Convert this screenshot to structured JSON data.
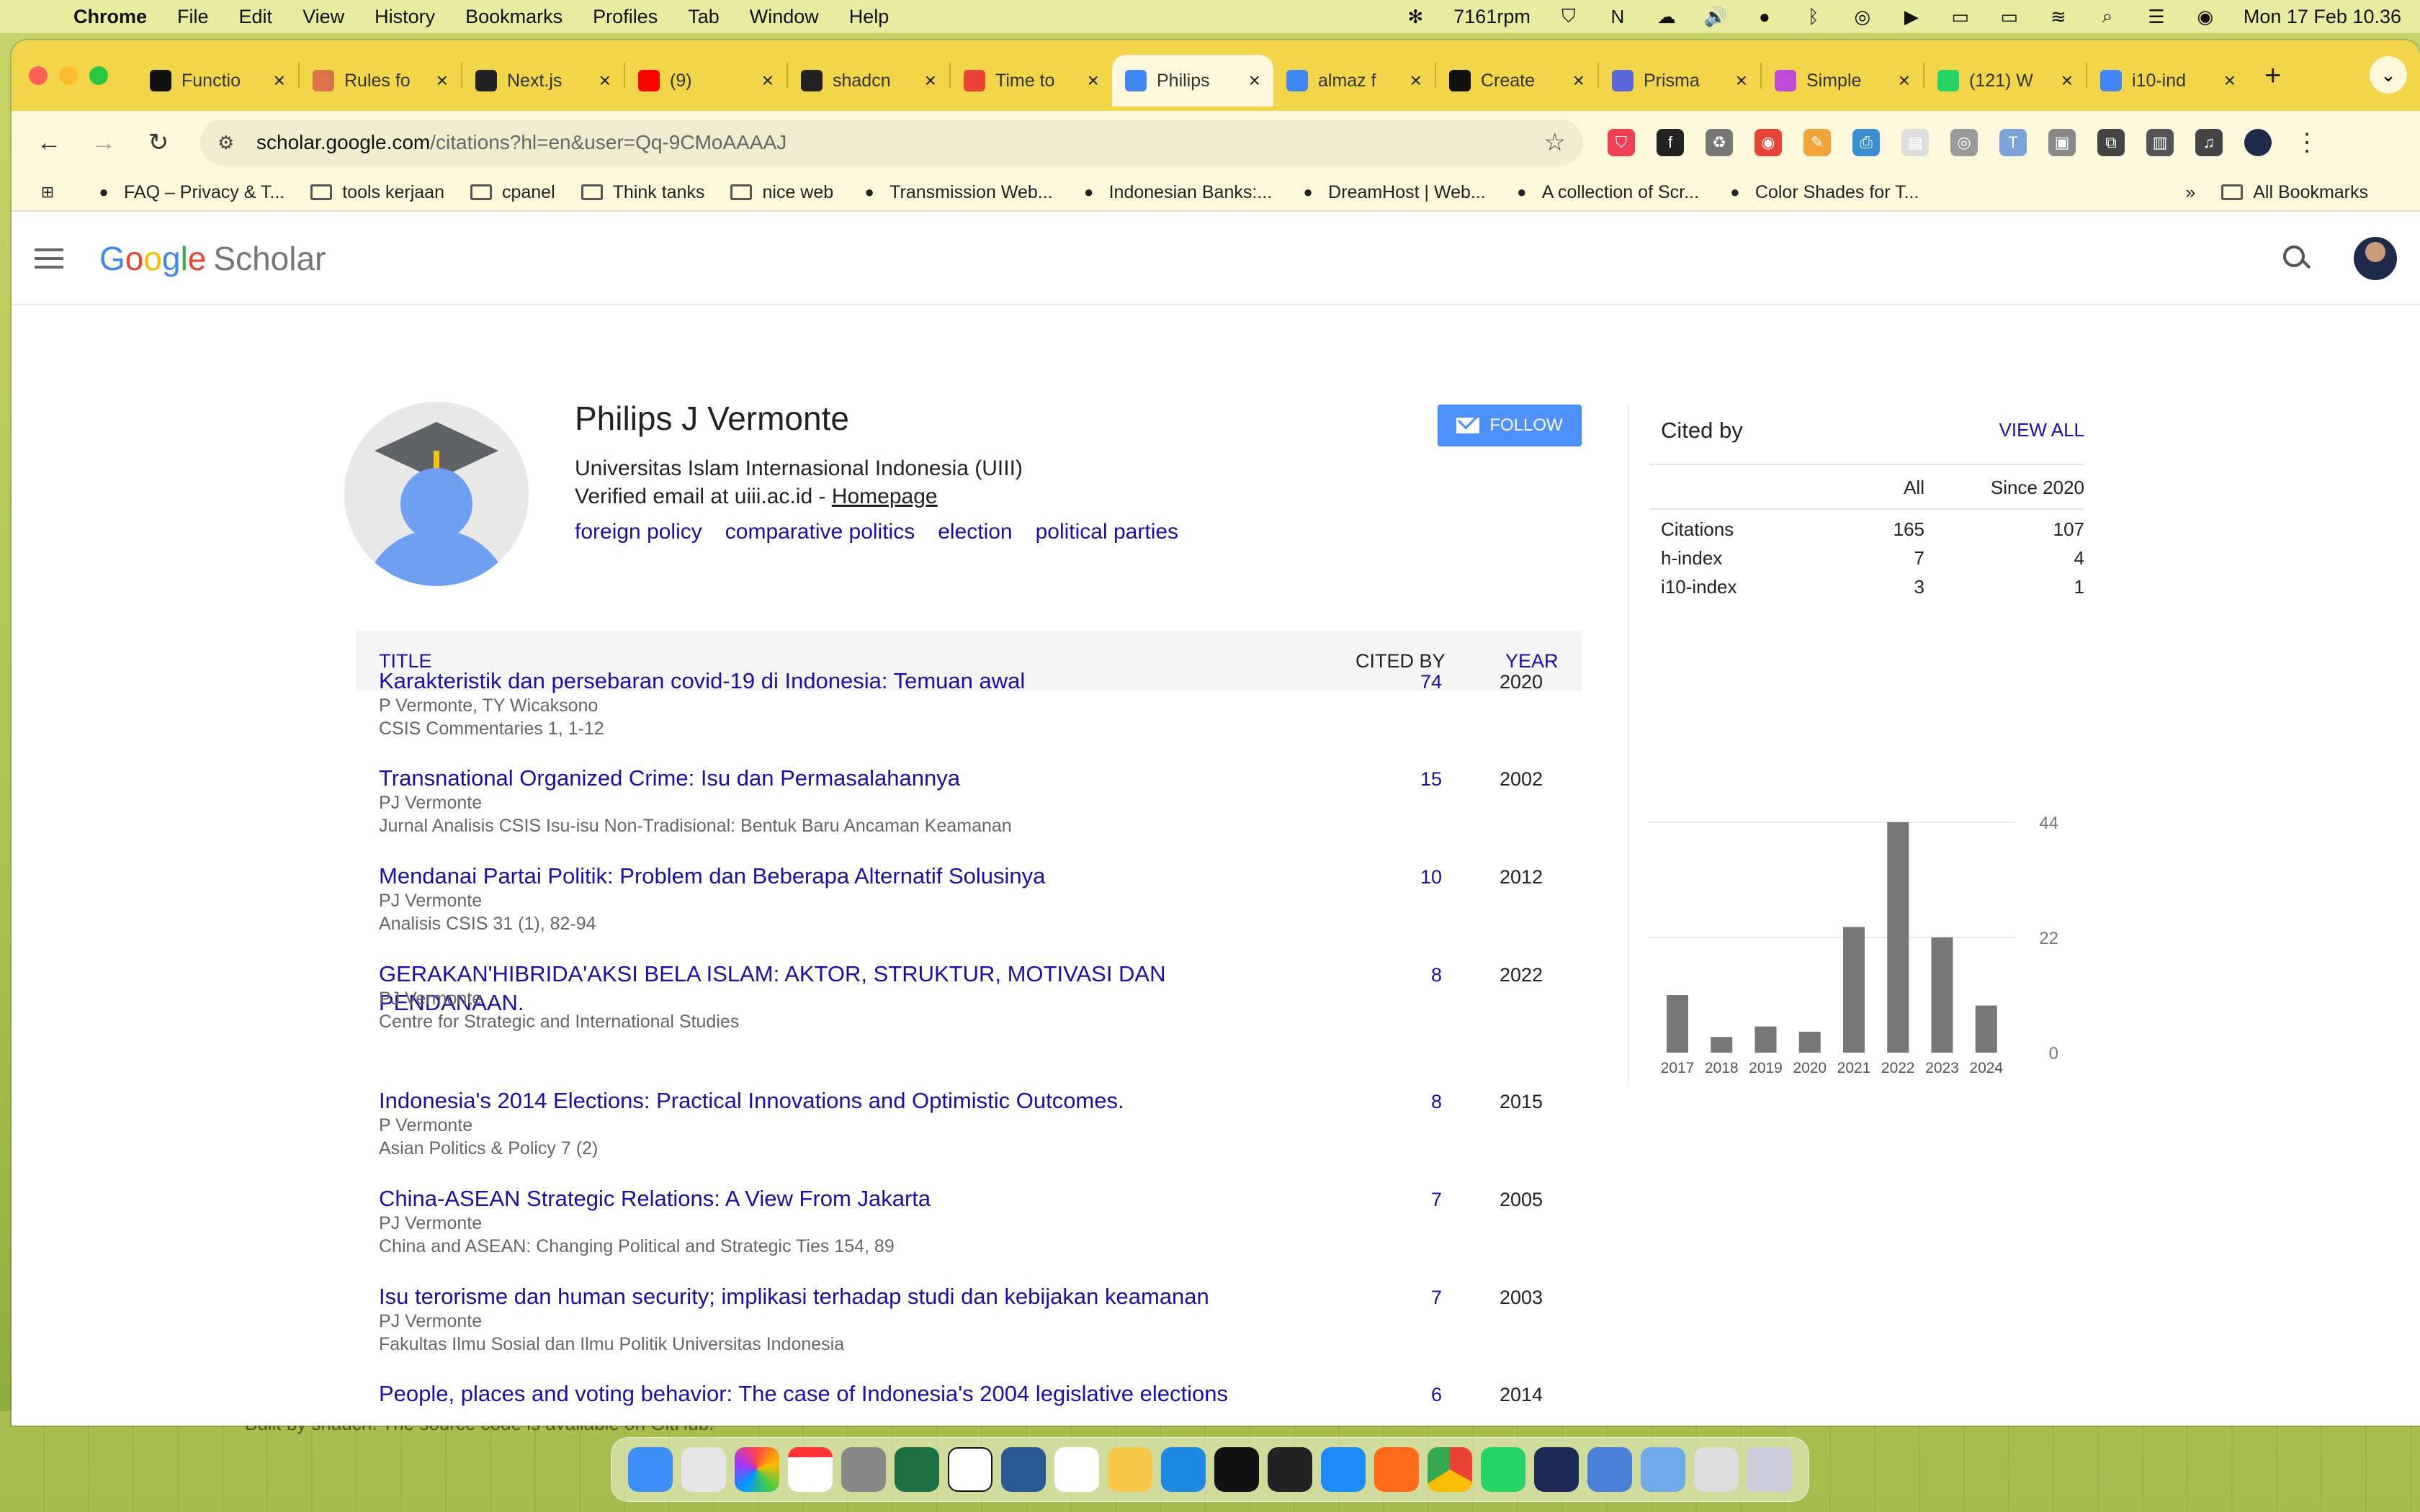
{
  "menubar": {
    "app": "Chrome",
    "items": [
      "File",
      "Edit",
      "View",
      "History",
      "Bookmarks",
      "Profiles",
      "Tab",
      "Window",
      "Help"
    ],
    "fan_rpm": "7161rpm",
    "datetime": "Mon 17 Feb  10.36"
  },
  "tabs": [
    {
      "label": "Functio",
      "color": "#111111"
    },
    {
      "label": "Rules fo",
      "color": "#d9734a"
    },
    {
      "label": "Next.js",
      "color": "#222222"
    },
    {
      "label": "(9)",
      "color": "#ff0000"
    },
    {
      "label": "shadcn",
      "color": "#222222"
    },
    {
      "label": "Time to",
      "color": "#ea4335"
    },
    {
      "label": "Philips",
      "color": "#4285f4"
    },
    {
      "label": "almaz f",
      "color": "#4285f4"
    },
    {
      "label": "Create",
      "color": "#111111"
    },
    {
      "label": "Prisma",
      "color": "#5a67d8"
    },
    {
      "label": "Simple",
      "color": "#c04bd8"
    },
    {
      "label": "(121) W",
      "color": "#25d366"
    },
    {
      "label": "i10-ind",
      "color": "#4285f4"
    }
  ],
  "toolbar": {
    "url_host": "scholar.google.com",
    "url_path": "/citations?hl=en&user=Qq-9CMoAAAAJ"
  },
  "bookmarks": [
    {
      "label": "FAQ – Privacy & T...",
      "type": "site"
    },
    {
      "label": "tools kerjaan",
      "type": "folder"
    },
    {
      "label": "cpanel",
      "type": "folder"
    },
    {
      "label": "Think tanks",
      "type": "folder"
    },
    {
      "label": "nice web",
      "type": "folder"
    },
    {
      "label": "Transmission Web...",
      "type": "site"
    },
    {
      "label": "Indonesian Banks:...",
      "type": "site"
    },
    {
      "label": "DreamHost | Web...",
      "type": "site"
    },
    {
      "label": "A collection of Scr...",
      "type": "site"
    },
    {
      "label": "Color Shades for T...",
      "type": "site"
    }
  ],
  "all_bookmarks": "All Bookmarks",
  "scholar": {
    "logo_g": [
      "G",
      "o",
      "o",
      "g",
      "l",
      "e"
    ],
    "logo_word": "Scholar"
  },
  "profile": {
    "name": "Philips J Vermonte",
    "affiliation": "Universitas Islam Internasional Indonesia (UIII)",
    "email_text": "Verified email at uiii.ac.id - ",
    "homepage": "Homepage",
    "tags": [
      "foreign policy",
      "comparative politics",
      "election",
      "political parties"
    ],
    "follow_label": "FOLLOW"
  },
  "table": {
    "headers": {
      "title": "TITLE",
      "cited_by": "CITED BY",
      "year": "YEAR"
    },
    "rows": [
      {
        "title": "Karakteristik dan persebaran covid-19 di Indonesia: Temuan awal",
        "authors": "P Vermonte, TY Wicaksono",
        "venue": "CSIS Commentaries 1, 1-12",
        "cited": "74",
        "year": "2020"
      },
      {
        "title": "Transnational Organized Crime: Isu dan Permasalahannya",
        "authors": "PJ Vermonte",
        "venue": "Jurnal Analisis CSIS Isu-isu Non-Tradisional: Bentuk Baru Ancaman Keamanan",
        "cited": "15",
        "year": "2002"
      },
      {
        "title": "Mendanai Partai Politik: Problem dan Beberapa Alternatif Solusinya",
        "authors": "PJ Vermonte",
        "venue": "Analisis CSIS 31 (1), 82-94",
        "cited": "10",
        "year": "2012"
      },
      {
        "title": "GERAKAN'HIBRIDA'AKSI BELA ISLAM: AKTOR, STRUKTUR, MOTIVASI DAN PENDANAAN.",
        "authors": "PJ Vermonte",
        "venue": "Centre for Strategic and International Studies",
        "cited": "8",
        "year": "2022"
      },
      {
        "title": "Indonesia's 2014 Elections: Practical Innovations and Optimistic Outcomes.",
        "authors": "P Vermonte",
        "venue": "Asian Politics & Policy 7 (2)",
        "cited": "8",
        "year": "2015"
      },
      {
        "title": "China-ASEAN Strategic Relations: A View From Jakarta",
        "authors": "PJ Vermonte",
        "venue": "China and ASEAN: Changing Political and Strategic Ties 154, 89",
        "cited": "7",
        "year": "2005"
      },
      {
        "title": "Isu terorisme dan human security; implikasi terhadap studi dan kebijakan keamanan",
        "authors": "PJ Vermonte",
        "venue": "Fakultas Ilmu Sosial dan Ilmu Politik Universitas Indonesia",
        "cited": "7",
        "year": "2003"
      },
      {
        "title": "People, places and voting behavior: The case of Indonesia's 2004 legislative elections",
        "authors": "",
        "venue": "",
        "cited": "6",
        "year": "2014"
      }
    ]
  },
  "cited_by": {
    "title": "Cited by",
    "view_all": "VIEW ALL",
    "col_all": "All",
    "col_since": "Since 2020",
    "rows": [
      {
        "label": "Citations",
        "all": "165",
        "since": "107"
      },
      {
        "label": "h-index",
        "all": "7",
        "since": "4"
      },
      {
        "label": "i10-index",
        "all": "3",
        "since": "1"
      }
    ]
  },
  "chart_data": {
    "type": "bar",
    "categories": [
      "2017",
      "2018",
      "2019",
      "2020",
      "2021",
      "2022",
      "2023",
      "2024"
    ],
    "values": [
      11,
      3,
      5,
      4,
      24,
      44,
      22,
      9
    ],
    "ylim": [
      0,
      44
    ],
    "yticks": [
      "44",
      "22",
      "0"
    ],
    "bar_color": "#777777",
    "grid": true
  },
  "footer_text": "Built by shadcn. The source code is available on GitHub."
}
